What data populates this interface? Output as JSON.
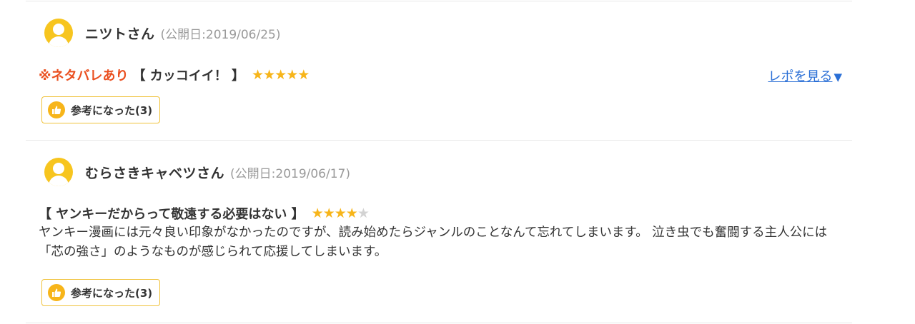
{
  "reviews": [
    {
      "user": "ニツトさん",
      "date": "(公開日:2019/06/25)",
      "spoiler": "※ネタバレあり",
      "title": "【 カッコイイ！ 】",
      "rating": 5,
      "stars": [
        "★",
        "★",
        "★",
        "★",
        "★"
      ],
      "report_link": "レポを見る",
      "report_arrow": "▼",
      "body": "",
      "helpful_label": "参考になった(3)"
    },
    {
      "user": "むらさきキャベツさん",
      "date": "(公開日:2019/06/17)",
      "spoiler": "",
      "title": "【 ヤンキーだからって敬遠する必要はない 】",
      "rating": 4,
      "stars": [
        "★",
        "★",
        "★",
        "★",
        "★"
      ],
      "report_link": "",
      "report_arrow": "",
      "body": "ヤンキー漫画には元々良い印象がなかったのですが、読み始めたらジャンルのことなんて忘れてしまいます。 泣き虫でも奮闘する主人公には「芯の強さ」のようなものが感じられて応援してしまいます。",
      "helpful_label": "参考になった(3)"
    }
  ],
  "colors": {
    "accent_yellow": "#f7b51a",
    "spoiler_red": "#ea4f1f",
    "link_blue": "#2a6fd6",
    "star_off": "#d3d3d3"
  },
  "icons": {
    "avatar": "user-avatar-icon",
    "thumb": "thumbs-up-icon",
    "star": "star-icon"
  }
}
